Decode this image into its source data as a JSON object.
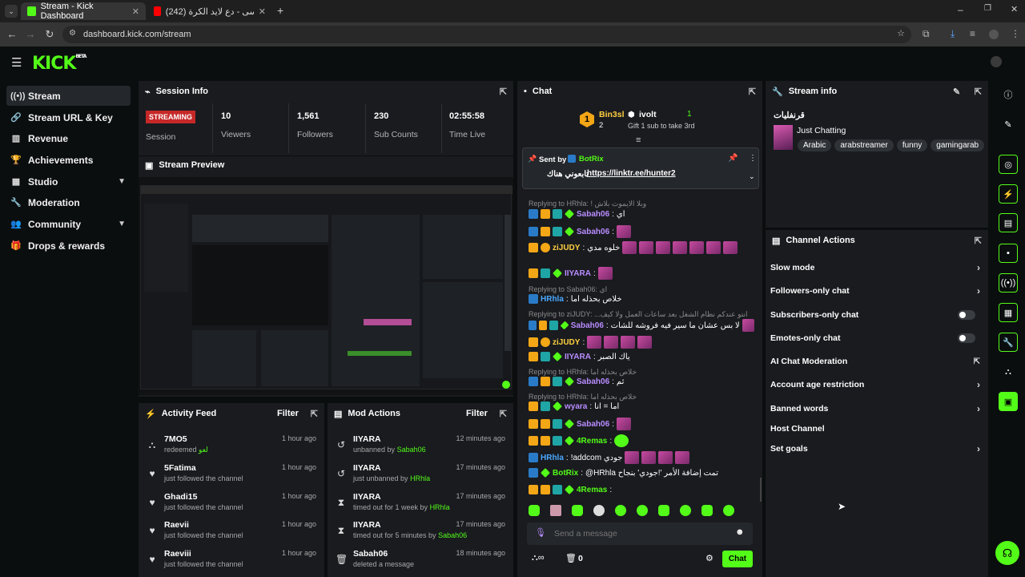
{
  "browser": {
    "tabs": [
      {
        "title": "Stream - Kick Dashboard"
      },
      {
        "title": "(242) عمر العيسى - دع لايد الكرة..."
      }
    ],
    "url": "dashboard.kick.com/stream"
  },
  "brand": {
    "logo": "KICK",
    "badge": "BETA",
    "accent": "#53fc18"
  },
  "sidebar": {
    "items": [
      {
        "label": "Stream",
        "icon": "broadcast-icon"
      },
      {
        "label": "Stream URL & Key",
        "icon": "link-icon"
      },
      {
        "label": "Revenue",
        "icon": "chart-icon"
      },
      {
        "label": "Achievements",
        "icon": "trophy-icon"
      },
      {
        "label": "Studio",
        "icon": "layout-icon"
      },
      {
        "label": "Moderation",
        "icon": "wrench-icon"
      },
      {
        "label": "Community",
        "icon": "people-icon"
      },
      {
        "label": "Drops & rewards",
        "icon": "gift-icon"
      }
    ]
  },
  "session": {
    "title": "Session Info",
    "status": "STREAMING",
    "status_label": "Session",
    "stats": [
      {
        "value": "10",
        "label": "Viewers"
      },
      {
        "value": "1,561",
        "label": "Followers"
      },
      {
        "value": "230",
        "label": "Sub Counts"
      },
      {
        "value": "02:55:58",
        "label": "Time Live"
      }
    ]
  },
  "preview": {
    "title": "Stream Preview"
  },
  "activity": {
    "title": "Activity Feed",
    "filter": "Filter",
    "items": [
      {
        "name": "7MO5",
        "sub": "redeemed",
        "extra": "لعو",
        "time": "1 hour ago"
      },
      {
        "name": "5Fatima",
        "sub": "just followed the channel",
        "time": "1 hour ago"
      },
      {
        "name": "Ghadi15",
        "sub": "just followed the channel",
        "time": "1 hour ago"
      },
      {
        "name": "Raevii",
        "sub": "just followed the channel",
        "time": "1 hour ago"
      },
      {
        "name": "Raeviii",
        "sub": "just followed the channel",
        "time": "1 hour ago"
      }
    ]
  },
  "mod": {
    "title": "Mod Actions",
    "filter": "Filter",
    "items": [
      {
        "name": "IIYARA",
        "sub": "unbanned by",
        "by": "Sabah06",
        "time": "12 minutes ago"
      },
      {
        "name": "IIYARA",
        "sub": "just unbanned by",
        "by": "HRhla",
        "time": "17 minutes ago"
      },
      {
        "name": "IIYARA",
        "sub": "timed out for 1 week by",
        "by": "HRhla",
        "time": "17 minutes ago"
      },
      {
        "name": "IIYARA",
        "sub": "timed out for 5 minutes by",
        "by": "Sabah06",
        "time": "17 minutes ago"
      },
      {
        "name": "Sabah06",
        "sub": "deleted a message",
        "by": "",
        "time": "18 minutes ago"
      }
    ]
  },
  "chat": {
    "title": "Chat",
    "top": [
      {
        "rank": "1",
        "name": "Bin3sl",
        "count": "2"
      },
      {
        "name": "ivolt",
        "count": "1"
      }
    ],
    "gift_text": "Gift 1 sub to take 3rd",
    "pinned": {
      "sent_by": "Sent by",
      "user": "BotRix",
      "text": "تابعوني هناك",
      "link": "https://linktr.ee/hunter2"
    },
    "lines": [
      {
        "type": "reply",
        "text": "Replying to HRhla: ! وبلا الايموت بلاش"
      },
      {
        "type": "msg",
        "user": "Sabah06",
        "color": "u-purple",
        "text": "اي"
      },
      {
        "type": "msg",
        "user": "Sabah06",
        "color": "u-purple",
        "text": "",
        "emotes": 1
      },
      {
        "type": "msg",
        "user": "ziJUDY",
        "color": "u-yellow",
        "text": "خلوه مدي",
        "emotes": 7
      },
      {
        "type": "msg",
        "user": "IIYARA",
        "color": "u-purple",
        "text": "",
        "emotes": 1
      },
      {
        "type": "reply",
        "text": "Replying to Sabah06: اي"
      },
      {
        "type": "msg",
        "user": "HRhla",
        "color": "u-blue",
        "text": "خلاص بحذله اما"
      },
      {
        "type": "reply",
        "text": "Replying to ziJUDY: ...انتو عندكم نظام الشغل بعد ساعات العمل ولا كيف"
      },
      {
        "type": "msg",
        "user": "Sabah06",
        "color": "u-purple",
        "text": "لا بس عشان ما سير فيه فروشه للشات",
        "emotes": 1
      },
      {
        "type": "msg",
        "user": "ziJUDY",
        "color": "u-yellow",
        "text": "",
        "emotes": 4
      },
      {
        "type": "msg",
        "user": "IIYARA",
        "color": "u-purple",
        "text": "ياك الصبر"
      },
      {
        "type": "reply",
        "text": "Replying to HRhla: خلاص بحذله اما"
      },
      {
        "type": "msg",
        "user": "Sabah06",
        "color": "u-purple",
        "text": "ثم"
      },
      {
        "type": "reply",
        "text": "Replying to HRhla: خلاص بحذله اما"
      },
      {
        "type": "msg",
        "user": "wyara",
        "color": "u-purple",
        "text": "اما = انا"
      },
      {
        "type": "msg",
        "user": "Sabah06",
        "color": "u-purple",
        "text": "",
        "emotes": 1
      },
      {
        "type": "msg",
        "user": "4Remas",
        "color": "u-green",
        "text": "",
        "emotes": 1
      },
      {
        "type": "msg",
        "user": "HRhla",
        "color": "u-blue",
        "text": "!addcom جودي",
        "emotes": 4
      },
      {
        "type": "msg",
        "user": "BotRix",
        "color": "u-green",
        "text": "@HRhla تمت إضافة الأمر '!جودي' بنجاح"
      },
      {
        "type": "msg",
        "user": "4Remas",
        "color": "u-green",
        "text": ""
      }
    ],
    "placeholder": "Send a message",
    "counter": "0",
    "chat_button": "Chat"
  },
  "stream_info": {
    "title": "Stream info",
    "stream_title": "قرنفليات",
    "category": "Just Chatting",
    "tags": [
      "Arabic",
      "arabstreamer",
      "funny",
      "gamingarab"
    ]
  },
  "channel_actions": {
    "title": "Channel Actions",
    "items": [
      {
        "label": "Slow mode",
        "control": "arrow"
      },
      {
        "label": "Followers-only chat",
        "control": "arrow"
      },
      {
        "label": "Subscribers-only chat",
        "control": "toggle"
      },
      {
        "label": "Emotes-only chat",
        "control": "toggle"
      },
      {
        "label": "AI Chat Moderation",
        "control": "external"
      },
      {
        "label": "Account age restriction",
        "control": "arrow"
      },
      {
        "label": "Banned words",
        "control": "arrow"
      },
      {
        "label": "Host Channel",
        "control": "none"
      },
      {
        "label": "Set goals",
        "control": "arrow"
      }
    ]
  }
}
